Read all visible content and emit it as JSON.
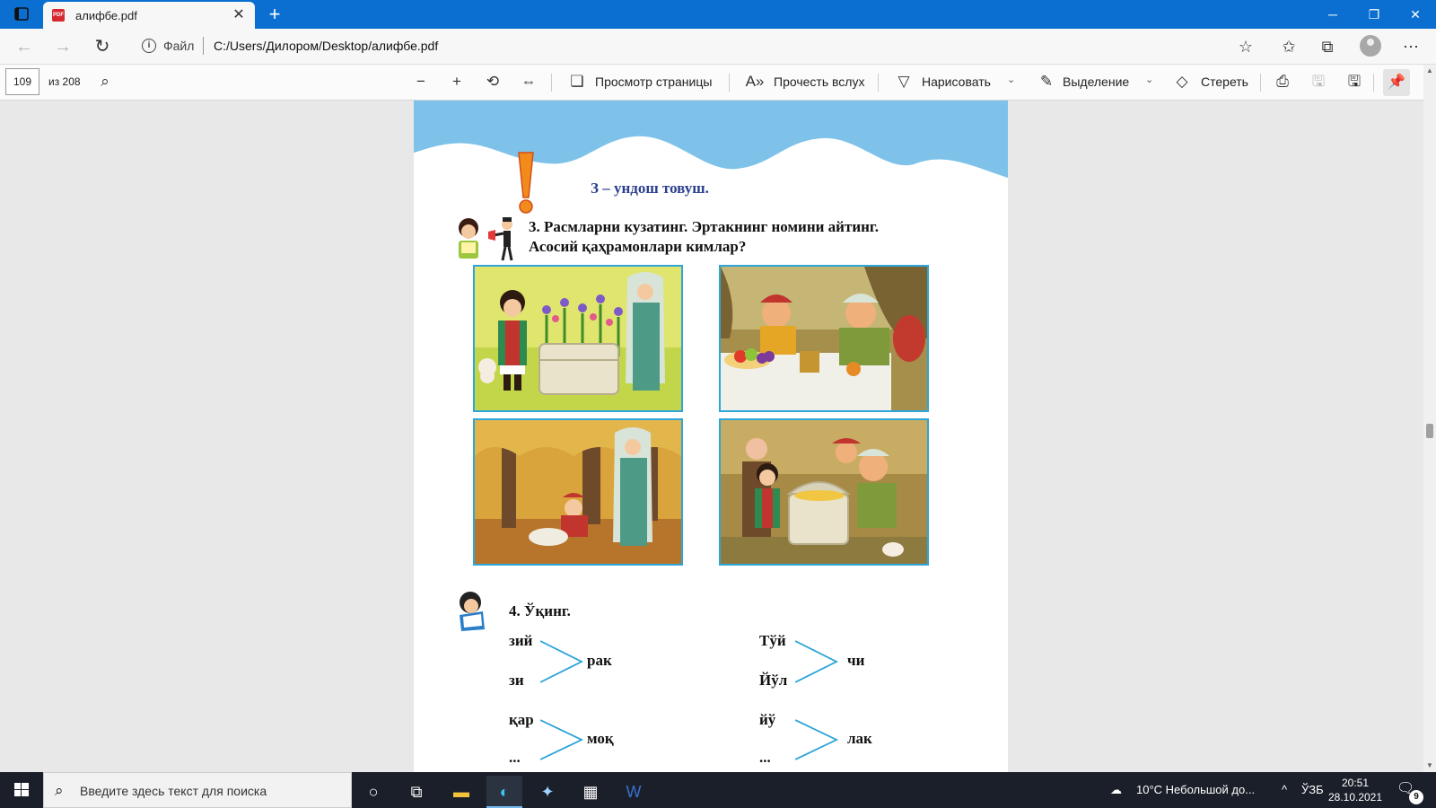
{
  "browser": {
    "tab_title": "алифбе.pdf",
    "url_scheme": "Файл",
    "url": "C:/Users/Дилором/Desktop/алифбе.pdf"
  },
  "pdf_toolbar": {
    "page_current": "109",
    "page_total": "из 208",
    "page_view_label": "Просмотр страницы",
    "read_aloud_label": "Прочесть вслух",
    "draw_label": "Нарисовать",
    "highlight_label": "Выделение",
    "erase_label": "Стереть"
  },
  "page": {
    "rule": "З – ундош товуш.",
    "exercise3": {
      "line1": "3. Расмларни кузатинг. Эртакнинг номини айтинг.",
      "line2": "Асосий қаҳрамонлари кимлар?"
    },
    "exercise4": {
      "title": "4. Ўқинг.",
      "groups": [
        {
          "left": [
            "зий",
            "зи"
          ],
          "right": "рак"
        },
        {
          "left": [
            "Тўй",
            "Йўл"
          ],
          "right": "чи"
        },
        {
          "left": [
            "қар",
            "..."
          ],
          "right": "моқ"
        },
        {
          "left": [
            "йў",
            "..."
          ],
          "right": "лак"
        }
      ]
    }
  },
  "taskbar": {
    "search_placeholder": "Введите здесь текст для поиска",
    "weather": "10°C  Небольшой до...",
    "lang": "ЎЗБ",
    "time": "20:51",
    "date": "28.10.2021",
    "notifications": "9"
  },
  "colors": {
    "titlebar": "#0a6fd0",
    "sky": "#7ec2ea",
    "frame": "#2fa6d9",
    "rule_text": "#2b3f8f"
  }
}
